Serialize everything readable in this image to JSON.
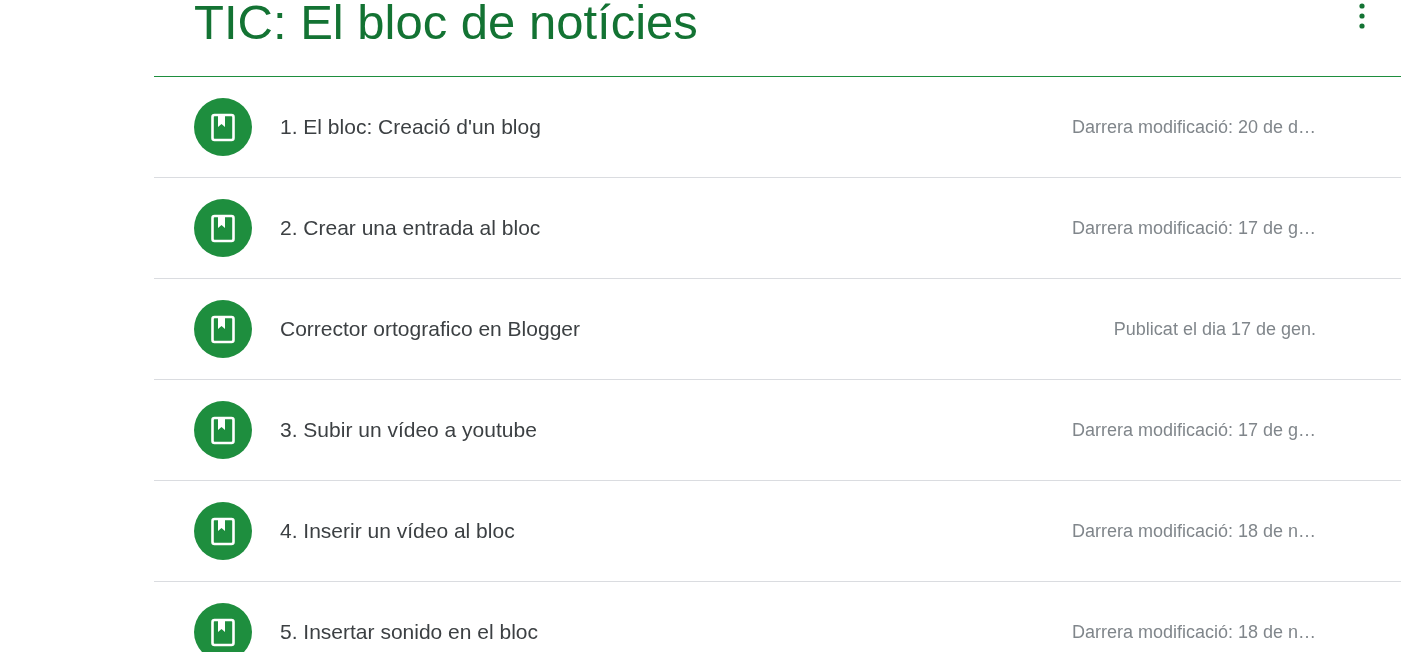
{
  "header": {
    "title": "TIC: El bloc de notícies"
  },
  "items": [
    {
      "title": "1. El bloc: Creació d'un blog",
      "date": "Darrera modificació: 20 de d…"
    },
    {
      "title": "2. Crear una entrada al bloc",
      "date": "Darrera modificació: 17 de g…"
    },
    {
      "title": "Corrector ortografico en Blogger",
      "date": "Publicat el dia 17 de gen."
    },
    {
      "title": "3. Subir un vídeo a youtube",
      "date": "Darrera modificació: 17 de g…"
    },
    {
      "title": "4. Inserir un vídeo al bloc",
      "date": "Darrera modificació: 18 de n…"
    },
    {
      "title": "5. Insertar sonido en el bloc",
      "date": "Darrera modificació: 18 de n…"
    }
  ]
}
